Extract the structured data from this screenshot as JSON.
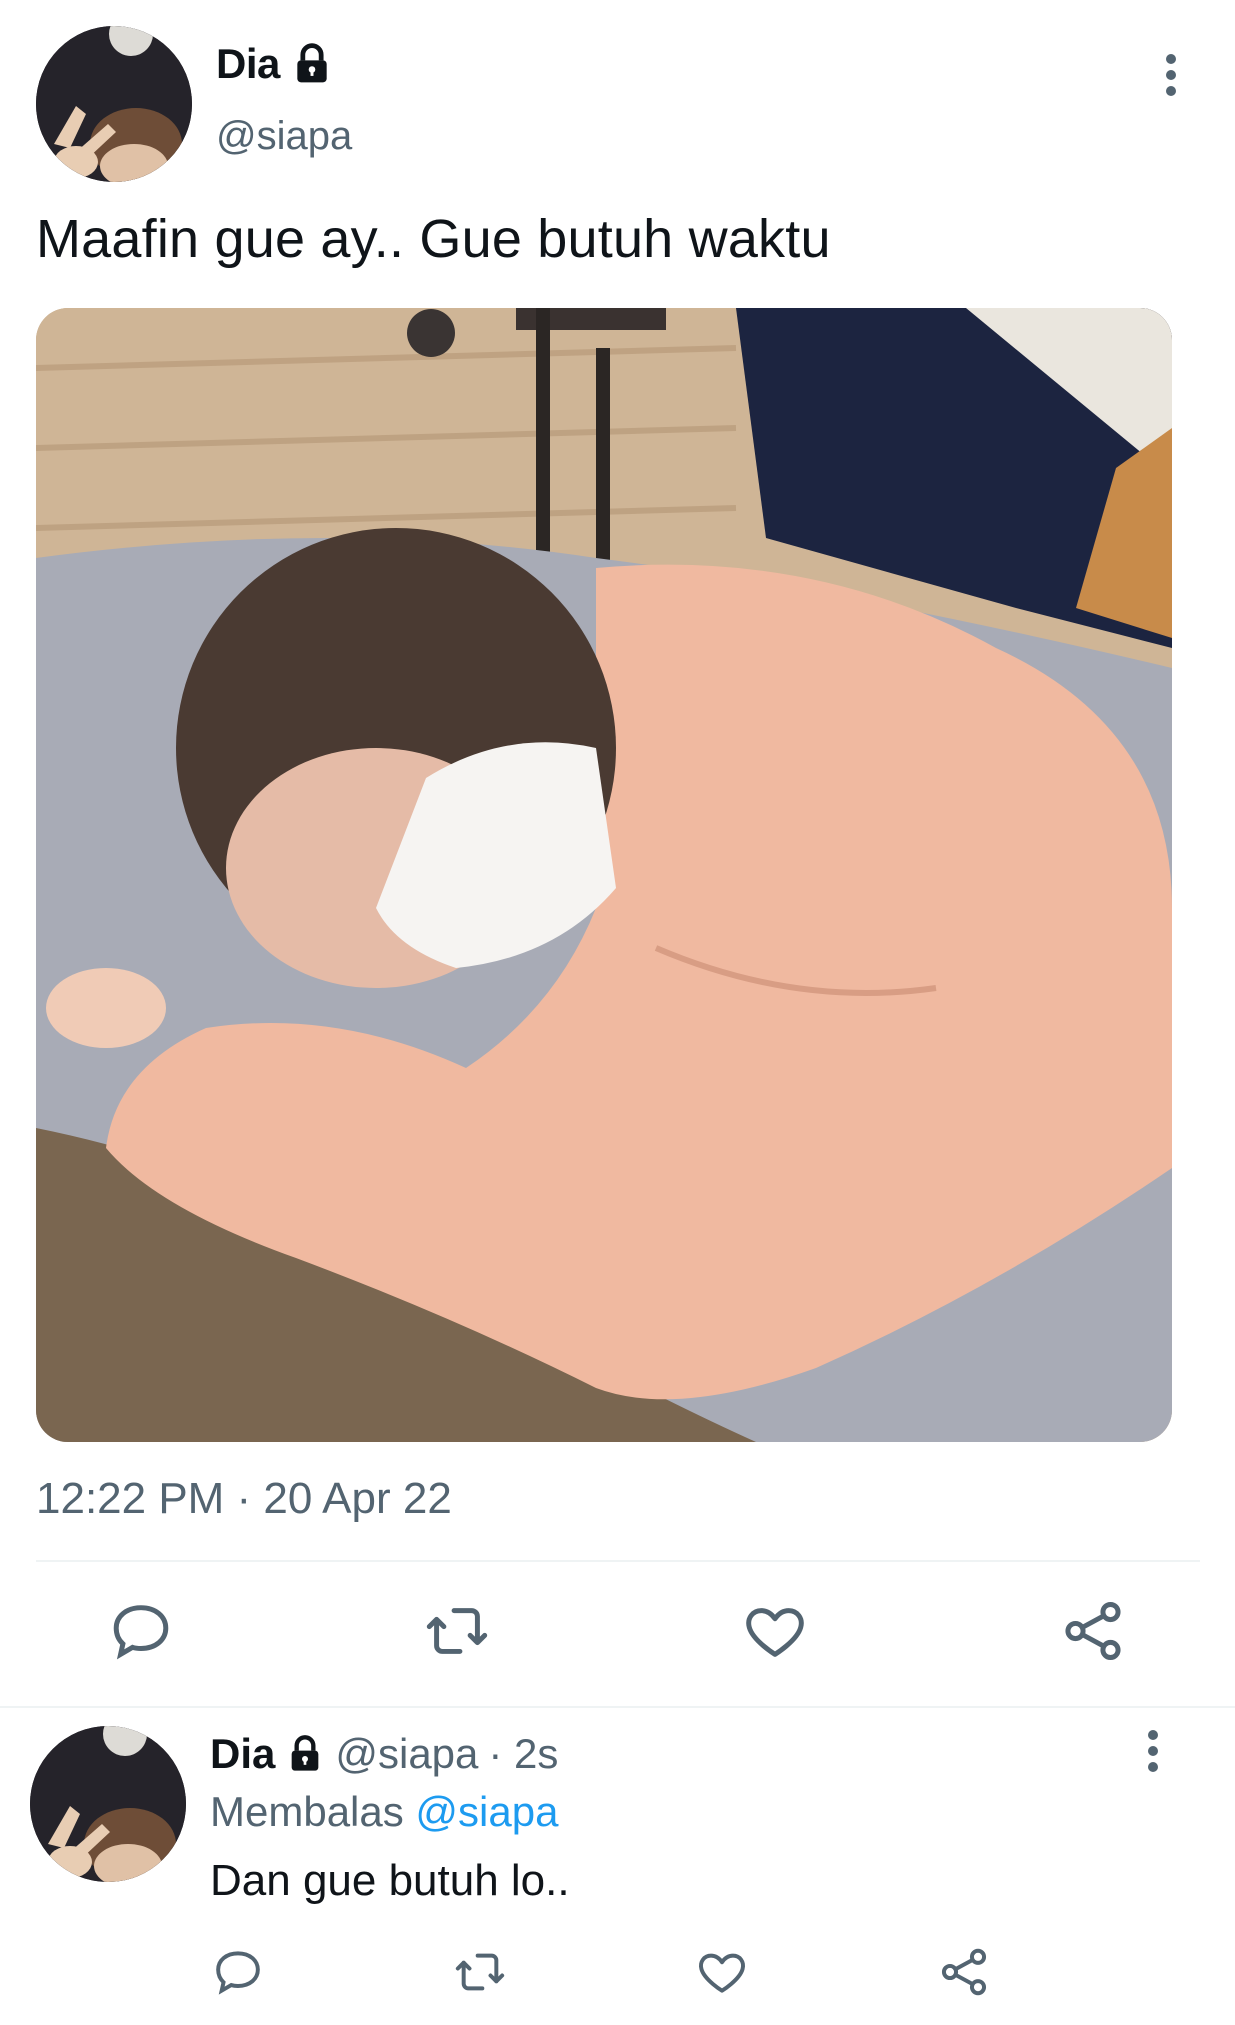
{
  "tweet": {
    "author_name": "Dia",
    "author_handle": "@siapa",
    "text": "Maafin gue ay.. Gue butuh waktu",
    "timestamp": "12:22 PM · 20 Apr 22",
    "icons": {
      "protected": "lock-icon",
      "more": "more-vertical-icon",
      "reply": "reply-icon",
      "retweet": "retweet-icon",
      "like": "heart-icon",
      "share": "share-icon"
    }
  },
  "reply": {
    "author_name": "Dia",
    "author_handle": "@siapa",
    "age": "· 2s",
    "replying_prefix": "Membalas",
    "replying_to": "@siapa",
    "text": "Dan gue butuh lo.."
  },
  "colors": {
    "text_primary": "#0f1419",
    "text_secondary": "#536471",
    "link": "#1d9bf0",
    "divider": "#eff3f4"
  }
}
